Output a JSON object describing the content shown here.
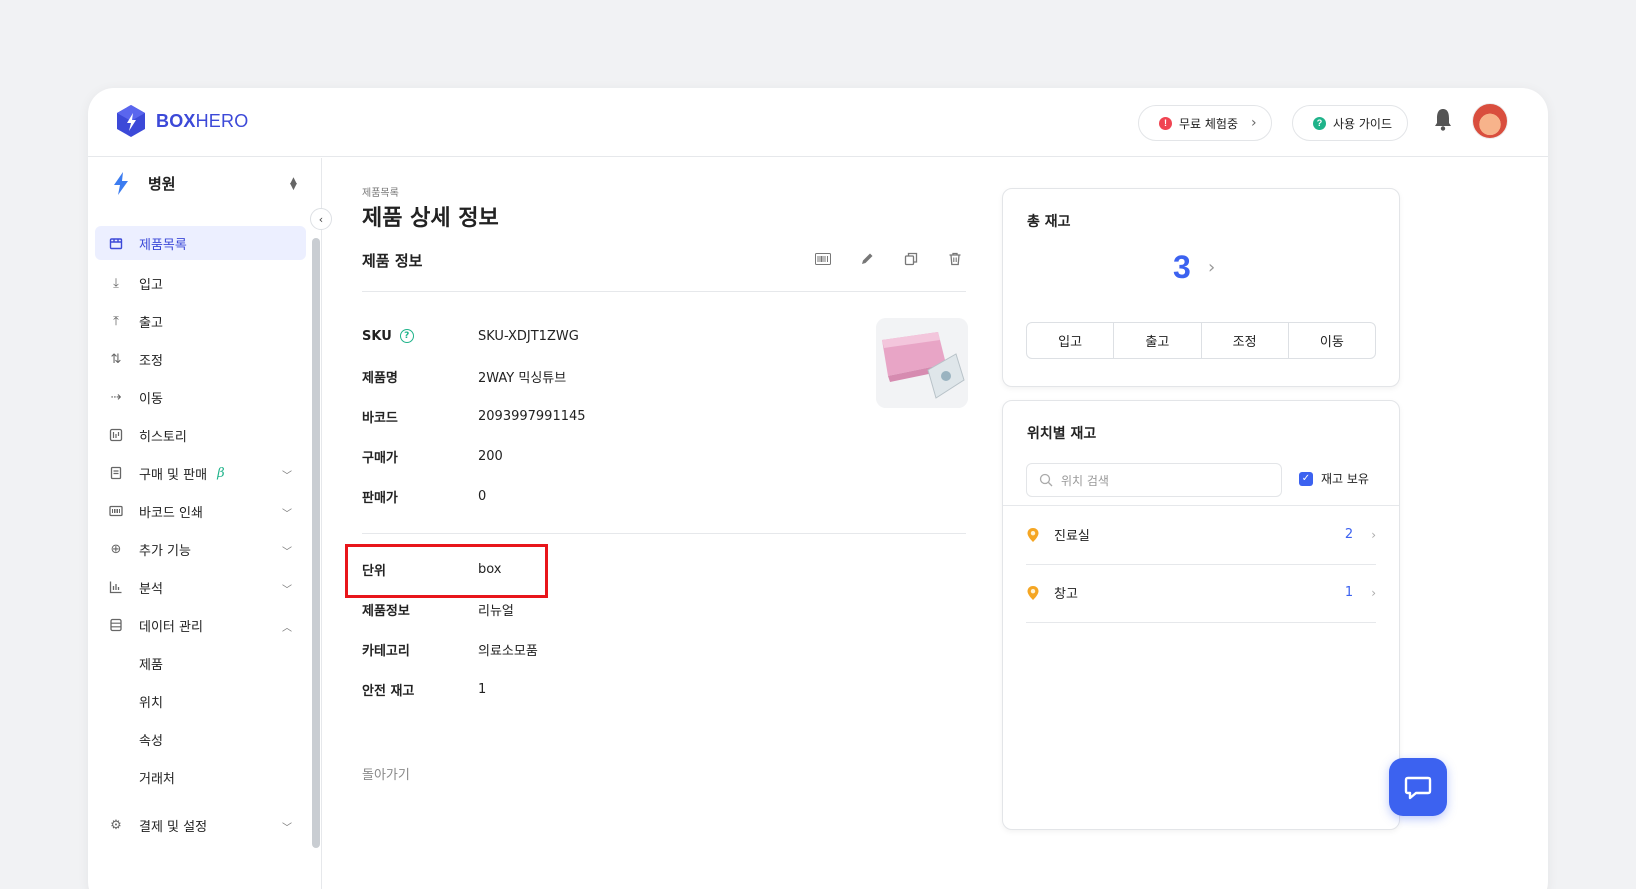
{
  "brand": {
    "bold": "BOX",
    "light": "HERO"
  },
  "header": {
    "trial_label": "무료 체험중",
    "trial_badge": "!",
    "guide_label": "사용 가이드",
    "guide_badge": "?"
  },
  "sidebar": {
    "org_name": "병원",
    "items": [
      {
        "label": "제품목록",
        "icon": "box-icon"
      },
      {
        "label": "입고",
        "icon": "arrow-down-icon"
      },
      {
        "label": "출고",
        "icon": "arrow-up-icon"
      },
      {
        "label": "조정",
        "icon": "swap-icon"
      },
      {
        "label": "이동",
        "icon": "move-icon"
      },
      {
        "label": "히스토리",
        "icon": "history-icon"
      },
      {
        "label": "구매 및 판매",
        "icon": "document-icon",
        "beta": "β"
      },
      {
        "label": "바코드 인쇄",
        "icon": "barcode-icon"
      },
      {
        "label": "추가 기능",
        "icon": "plus-circle-icon"
      },
      {
        "label": "분석",
        "icon": "chart-icon"
      },
      {
        "label": "데이터 관리",
        "icon": "database-icon"
      }
    ],
    "sub_items": [
      "제품",
      "위치",
      "속성",
      "거래처"
    ],
    "bottom_item": "결제 및 설정"
  },
  "main": {
    "breadcrumb": "제품목록",
    "title": "제품 상세 정보",
    "section_title": "제품 정보",
    "fields": [
      {
        "key": "SKU",
        "value": "SKU-XDJT1ZWG"
      },
      {
        "key": "제품명",
        "value": "2WAY 믹싱튜브"
      },
      {
        "key": "바코드",
        "value": "2093997991145"
      },
      {
        "key": "구매가",
        "value": "200"
      },
      {
        "key": "판매가",
        "value": "0"
      }
    ],
    "attributes": [
      {
        "key": "단위",
        "value": "box"
      },
      {
        "key": "제품정보",
        "value": "리뉴얼"
      },
      {
        "key": "카테고리",
        "value": "의료소모품"
      },
      {
        "key": "안전 재고",
        "value": "1"
      }
    ],
    "back_label": "돌아가기"
  },
  "stock": {
    "title": "총 재고",
    "total": "3",
    "buttons": [
      "입고",
      "출고",
      "조정",
      "이동"
    ]
  },
  "locations": {
    "title": "위치별 재고",
    "search_placeholder": "위치 검색",
    "checkbox_label": "재고 보유",
    "rows": [
      {
        "name": "진료실",
        "count": "2"
      },
      {
        "name": "창고",
        "count": "1"
      }
    ]
  },
  "colors": {
    "accent": "#3c62f0",
    "brand": "#3c49d8",
    "highlight": "#e8151b",
    "pin": "#f5a623"
  }
}
